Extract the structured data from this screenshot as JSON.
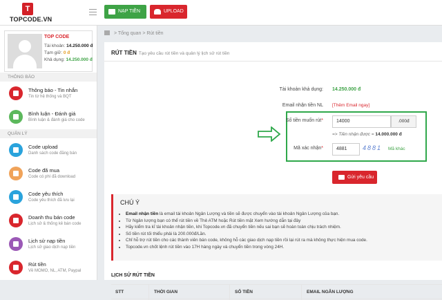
{
  "header": {
    "logo_text": "TOPCODE.VN",
    "logo_mark": "T",
    "nap_tien": "NẠP TIỀN",
    "upload": "UPLOAD"
  },
  "profile": {
    "name": "TOP CODE",
    "balance_label": "Tài khoản:",
    "balance_value": "14.250.000",
    "balance_unit": "đ",
    "hold_label": "Tạm giữ:",
    "hold_value": "0",
    "hold_unit": "đ",
    "available_label": "Khả dụng:",
    "available_value": "14.250.000",
    "available_unit": "đ"
  },
  "sidebar": {
    "section_notify": "THÔNG BÁO",
    "section_manage": "QUẢN LÝ",
    "items": [
      {
        "title": "Thông báo - Tin nhắn",
        "sub": "Tin từ hệ thống và BQT",
        "color": "#d9262d"
      },
      {
        "title": "Bình luận - Đánh giá",
        "sub": "Bình luận & đánh giá cho code",
        "color": "#5cb85c"
      },
      {
        "title": "Code upload",
        "sub": "Danh sách code đăng bán",
        "color": "#2aa3dc"
      },
      {
        "title": "Code đã mua",
        "sub": "Code có phí đã download",
        "color": "#f0a35a"
      },
      {
        "title": "Code yêu thích",
        "sub": "Code yêu thích đã lưu lại",
        "color": "#2aa3dc"
      },
      {
        "title": "Doanh thu bán code",
        "sub": "Lịch sử & thống kê bán code",
        "color": "#d9262d"
      },
      {
        "title": "Lịch sử nạp tiền",
        "sub": "Lịch sử giao dịch nạp tiền",
        "color": "#9b59b6"
      },
      {
        "title": "Rút tiền",
        "sub": "Về MOMO, NL, ATM, Paypal",
        "color": "#d9262d"
      }
    ]
  },
  "breadcrumb": {
    "home": "Tổng quan",
    "sep": ">",
    "current": "Rút tiền"
  },
  "page": {
    "title": "RÚT TIỀN",
    "subtitle": "Tạo yêu cầu rút tiền và quản lý lịch sử rút tiền"
  },
  "form": {
    "account_balance_label": "Tài khoản khả dụng:",
    "account_balance_value": "14.250.000 đ",
    "email_label": "Email nhận tiền NL",
    "email_value": "[Thêm Email ngay]",
    "amount_label": "Số tiền muốn rút",
    "amount_value": "14000",
    "amount_addon": ".000đ",
    "received_hint_prefix": "=> Tiền nhận được =",
    "received_hint_value": "14.000.000 đ",
    "captcha_label": "Mã xác nhận",
    "captcha_value": "4881",
    "captcha_image_text": "4881",
    "captcha_other": "Mã khác",
    "submit": "Gửi yêu cầu"
  },
  "notice": {
    "title": "CHÚ Ý",
    "lines": [
      {
        "bold": "Email nhận tiền",
        "rest": " là email tài khoản Ngân Lượng và tiền sẽ được chuyển vào tài khoản Ngân Lượng của bạn."
      },
      {
        "bold": "",
        "rest": "Từ Ngân lượng bạn có thể rút tiền về Thẻ ATM hoặc Rút tiền mặt Xem hướng dẫn tại đây"
      },
      {
        "bold": "",
        "rest": "Hãy kiểm tra kĩ tài khoản nhận tiền, khi Topcode.vn đã chuyển tiền nếu sai bạn sẽ hoàn toàn chịu trách nhiệm."
      },
      {
        "bold": "",
        "rest": "Số tiền rút tối thiểu phải là 200.000đ/Lần."
      },
      {
        "bold": "",
        "rest": "Chỉ hỗ trợ rút tiền cho các thành viên bán code, không hỗ các giao dịch nạp tiền rồi lại rút ra mà không thực hiện mua code."
      },
      {
        "bold": "",
        "rest": "Topcode.vn chốt lệnh rút tiền vào 17H hàng ngày và chuyển tiền trong vòng 24H."
      }
    ]
  },
  "history": {
    "title": "LỊCH SỬ RÚT TIỀN",
    "columns": [
      "STT",
      "THỜI GIAN",
      "SỐ TIỀN",
      "EMAIL NGÂN LƯỢNG"
    ]
  }
}
